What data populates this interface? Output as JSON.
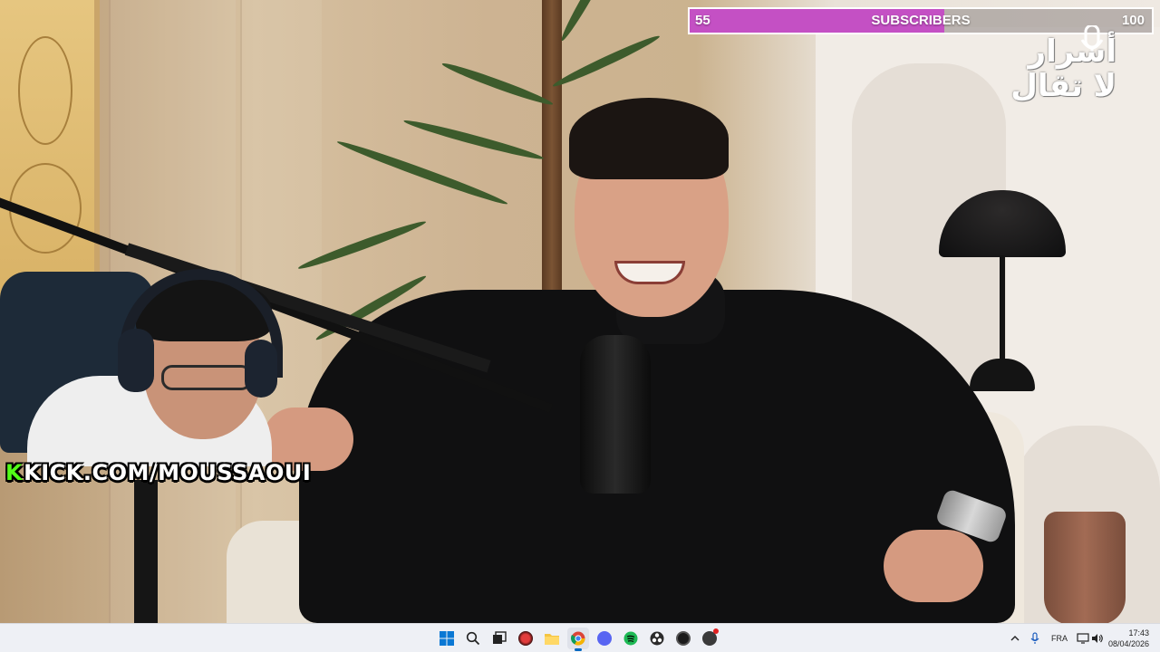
{
  "overlay": {
    "goal": {
      "start": "55",
      "title": "SUBSCRIBERS",
      "end": "100",
      "progress": 0.55,
      "fill_color": "#c450c4"
    },
    "logo_text": "أسرار لا تقال",
    "kick_watermark": {
      "k": "K",
      "text": "KICK.COM/MOUSSAOUI",
      "accent_color": "#53fc18"
    }
  },
  "taskbar": {
    "apps": [
      {
        "name": "start-button",
        "icon": "windows-icon"
      },
      {
        "name": "search-button",
        "icon": "search-icon"
      },
      {
        "name": "task-view-button",
        "icon": "task-view-icon"
      },
      {
        "name": "app-red",
        "icon": "app-red-icon"
      },
      {
        "name": "file-explorer",
        "icon": "folder-icon"
      },
      {
        "name": "chrome",
        "icon": "chrome-icon"
      },
      {
        "name": "discord",
        "icon": "discord-icon"
      },
      {
        "name": "spotify",
        "icon": "spotify-icon"
      },
      {
        "name": "obs",
        "icon": "obs-icon"
      },
      {
        "name": "app-dark",
        "icon": "app-dark-icon"
      },
      {
        "name": "app-notify",
        "icon": "app-notify-icon"
      }
    ],
    "tray": {
      "language": "FRA"
    },
    "clock": {
      "time": "17:43",
      "date": "08/04/2026"
    }
  }
}
